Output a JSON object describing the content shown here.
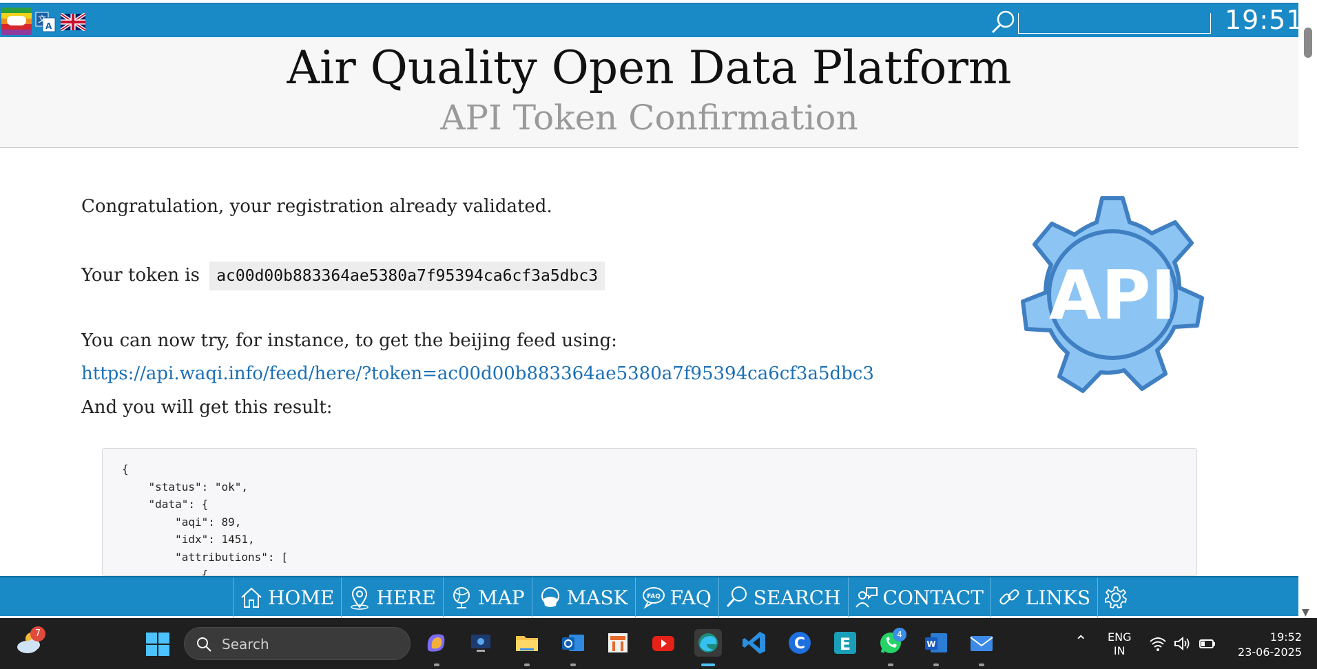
{
  "topbar": {
    "icons": [
      "aqicn-logo-icon",
      "translate-icon",
      "uk-flag-icon",
      "search-icon"
    ],
    "search_value": "",
    "clock": "19:51",
    "color": "#1a8ac6"
  },
  "header": {
    "title": "Air Quality Open Data Platform",
    "subtitle": "API Token Confirmation"
  },
  "content": {
    "line1": "Congratulation, your registration already validated.",
    "token_prefix": "Your token is",
    "token": "ac00d00b883364ae5380a7f95394ca6cf3a5dbc3",
    "line3": "You can now try, for instance, to get the beijing feed using:",
    "link": "https://api.waqi.info/feed/here/?token=ac00d00b883364ae5380a7f95394ca6cf3a5dbc3",
    "line4": "And you will get this result:",
    "api_logo_text": "API",
    "code": "{\n    \"status\": \"ok\",\n    \"data\": {\n        \"aqi\": 89,\n        \"idx\": 1451,\n        \"attributions\": [\n            {"
  },
  "bottom_nav": {
    "items": [
      {
        "label": "HOME",
        "icon": "home-icon"
      },
      {
        "label": "HERE",
        "icon": "location-pin-icon"
      },
      {
        "label": "MAP",
        "icon": "globe-icon"
      },
      {
        "label": "MASK",
        "icon": "mask-icon"
      },
      {
        "label": "FAQ",
        "icon": "faq-icon"
      },
      {
        "label": "SEARCH",
        "icon": "search-icon"
      },
      {
        "label": "CONTACT",
        "icon": "contact-icon"
      },
      {
        "label": "LINKS",
        "icon": "link-icon"
      },
      {
        "label": "",
        "icon": "settings-gear-icon"
      }
    ]
  },
  "taskbar": {
    "weather_badge": "7",
    "search_label": "Search",
    "whatsapp_badge": "4",
    "lang_line1": "ENG",
    "lang_line2": "IN",
    "time": "19:52",
    "date": "23-06-2025",
    "apps": [
      "copilot-icon",
      "remote-desktop-icon",
      "file-explorer-icon",
      "outlook-icon",
      "app-icon",
      "youtube-icon",
      "edge-icon",
      "vscode-icon",
      "c-app-icon",
      "e-app-icon",
      "whatsapp-icon",
      "word-icon",
      "mail-icon"
    ]
  }
}
